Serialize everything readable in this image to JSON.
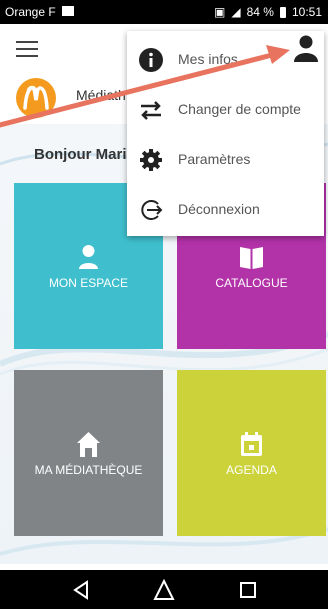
{
  "status_bar": {
    "carrier": "Orange F",
    "battery": "84 %",
    "time": "10:51"
  },
  "brand": {
    "name": "Médiath"
  },
  "greeting": "Bonjour Marina",
  "tiles": [
    {
      "label": "MON ESPACE",
      "icon": "person-icon",
      "color": "#3fbfcd"
    },
    {
      "label": "CATALOGUE",
      "icon": "book-icon",
      "color": "#b232a8"
    },
    {
      "label": "MA MÉDIATHÈQUE",
      "icon": "house-icon",
      "color": "#808487"
    },
    {
      "label": "AGENDA",
      "icon": "calendar-icon",
      "color": "#cbd23a"
    }
  ],
  "menu": {
    "items": [
      {
        "label": "Mes infos",
        "icon": "info-icon"
      },
      {
        "label": "Changer de compte",
        "icon": "swap-icon"
      },
      {
        "label": "Paramètres",
        "icon": "gear-icon"
      },
      {
        "label": "Déconnexion",
        "icon": "logout-icon"
      }
    ]
  },
  "colors": {
    "annotation_arrow": "#e8735f",
    "logo": "#f39a1f"
  }
}
